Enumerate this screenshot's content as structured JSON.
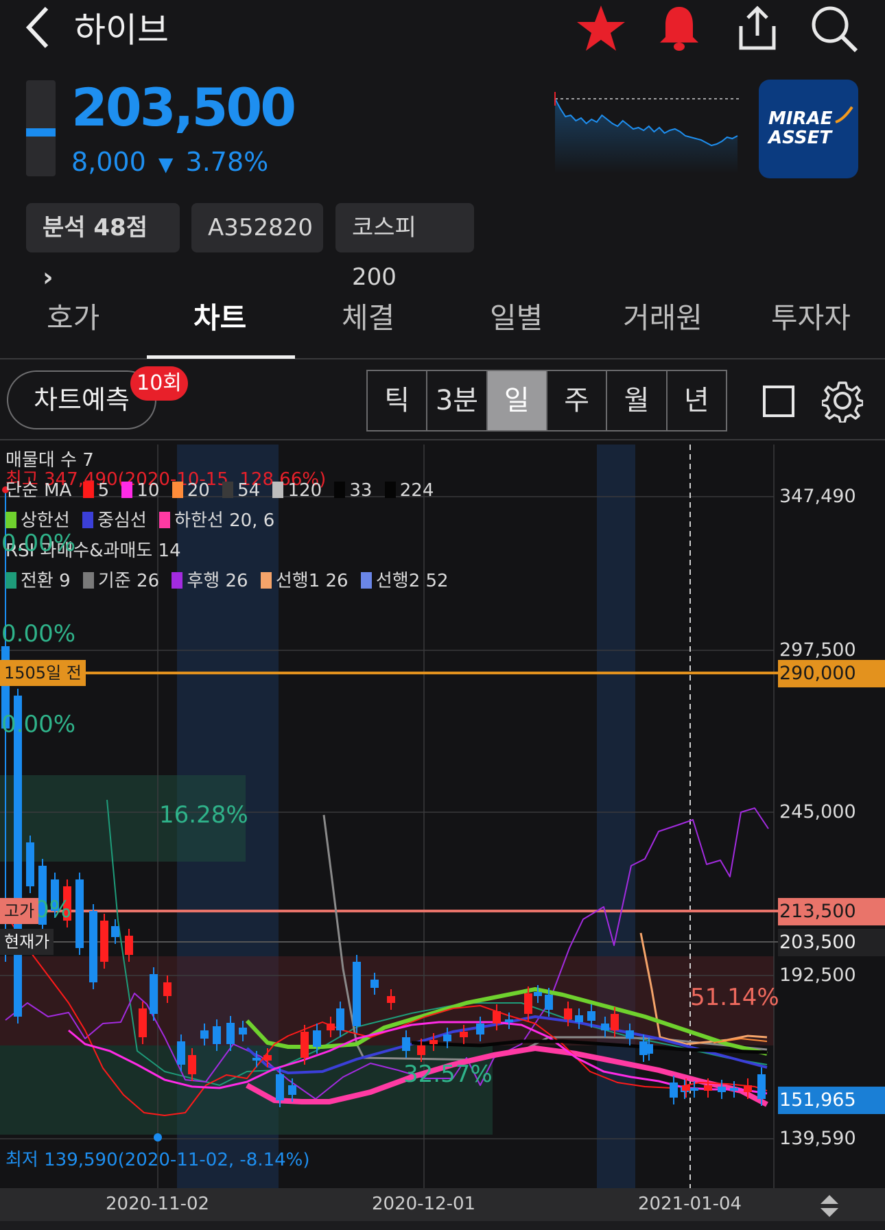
{
  "header": {
    "title": "하이브",
    "back_icon": "chevron-left-icon",
    "icons": [
      "star-icon",
      "bell-icon",
      "share-icon",
      "search-icon"
    ],
    "favorite_color": "#e8202a",
    "alert_color": "#e8202a"
  },
  "quote": {
    "price": "203,500",
    "change": "8,000",
    "direction_symbol": "▼",
    "change_pct": "3.78%",
    "down_color": "#1e8ff0",
    "broker_logo_line1": "MIRAE",
    "broker_logo_line2": "ASSET"
  },
  "chips": {
    "analysis": "분석 48점",
    "analysis_arrow": "›",
    "code": "A352820",
    "index": "코스피200"
  },
  "tabs": [
    {
      "label": "호가",
      "active": false
    },
    {
      "label": "차트",
      "active": true
    },
    {
      "label": "체결",
      "active": false
    },
    {
      "label": "일별",
      "active": false
    },
    {
      "label": "거래원",
      "active": false
    },
    {
      "label": "투자자",
      "active": false
    }
  ],
  "toolbar": {
    "predict_label": "차트예측",
    "predict_badge": "10회",
    "periods": [
      "틱",
      "3분",
      "일",
      "주",
      "월",
      "년"
    ],
    "selected_period": "일",
    "fullscreen_icon": "square-icon",
    "settings_icon": "gear-icon"
  },
  "chart": {
    "legend": {
      "volume_profile": "매물대 수 7",
      "high_label": "최고 347,490(2020-10-15, 128.66%)",
      "ma_title": "단순 MA",
      "ma_periods": [
        "5",
        "10",
        "20",
        "54",
        "120",
        "33",
        "224"
      ],
      "ma_colors": [
        "#ff1a1a",
        "#ff2be6",
        "#ff8c3a",
        "#3a3a3a",
        "#bdbdbd",
        "#050505",
        "#050505"
      ],
      "bollinger": [
        {
          "label": "상한선",
          "color": "#6fd12e"
        },
        {
          "label": "중심선",
          "color": "#3b3fd8"
        },
        {
          "label": "하한선 20, 6",
          "color": "#ff3aa3"
        }
      ],
      "rsi": "RSI 과매수&과매도 14",
      "ichimoku": [
        {
          "label": "전환 9",
          "color": "#1e9c7a"
        },
        {
          "label": "기준 26",
          "color": "#7a7a7a"
        },
        {
          "label": "후행 26",
          "color": "#a32be0"
        },
        {
          "label": "선행1 26",
          "color": "#f5a46a"
        },
        {
          "label": "선행2 52",
          "color": "#6a86e8"
        }
      ]
    },
    "volume_profile_pcts": [
      "0.00%",
      "0.00%",
      "0.00%",
      "16.28%",
      "0%",
      "51.14%",
      "32.57%"
    ],
    "days_ago_label": "1505일 전",
    "high_tag": "고가",
    "current_tag": "현재가",
    "low_label": "최저 139,590(2020-11-02, -8.14%)",
    "y_ticks": [
      "347,490",
      "297,500",
      "245,000",
      "192,500",
      "139,590"
    ],
    "y_markers": [
      {
        "label": "290,000",
        "kind": "days-ago-line",
        "color": "#e3921e"
      },
      {
        "label": "213,500",
        "kind": "high",
        "color": "#e9746a"
      },
      {
        "label": "203,500",
        "kind": "current",
        "color": "#222224"
      },
      {
        "label": "151,965",
        "kind": "last",
        "color": "#1a7fd6"
      }
    ],
    "x_ticks": [
      "2020-11-02",
      "2020-12-01",
      "2021-01-04"
    ]
  },
  "chart_data": {
    "type": "candlestick",
    "ylim": [
      139590,
      347490
    ],
    "x": [
      "2020-11-02",
      "2020-12-01",
      "2021-01-04"
    ],
    "levels": {
      "high": 213500,
      "current": 203500,
      "days_ago_line": 290000,
      "last": 151965,
      "period_high": 347490,
      "period_low": 139590
    },
    "series": [
      {
        "name": "상한선",
        "values": [
          179000,
          171000,
          168000
        ]
      },
      {
        "name": "중심선",
        "values": [
          160000,
          166000,
          158000
        ]
      },
      {
        "name": "하한선 20, 6",
        "values": [
          152000,
          157000,
          150000
        ]
      }
    ]
  }
}
